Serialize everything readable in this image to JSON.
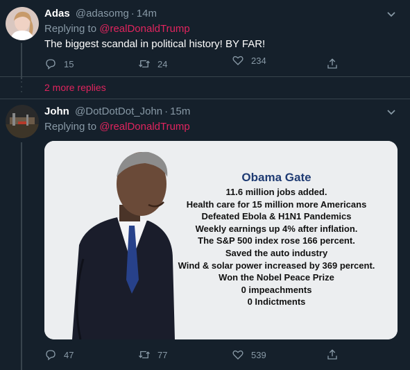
{
  "tweets": [
    {
      "name": "Adas",
      "handle": "@adasomg",
      "time": "14m",
      "replying_label": "Replying to",
      "mention": "@realDonaldTrump",
      "text": "The biggest scandal in political history! BY FAR!",
      "replies": "15",
      "retweets": "24",
      "likes": "234"
    },
    {
      "name": "John",
      "handle": "@DotDotDot_John",
      "time": "15m",
      "replying_label": "Replying to",
      "mention": "@realDonaldTrump",
      "replies": "47",
      "retweets": "77",
      "likes": "539",
      "media": {
        "title": "Obama Gate",
        "lines": [
          "11.6 million jobs added.",
          "Health care for 15 million more Americans",
          "Defeated Ebola & H1N1 Pandemics",
          "Weekly earnings up 4% after inflation.",
          "The S&P 500 index rose 166 percent.",
          "Saved the auto industry",
          "Wind & solar power increased by 369 percent.",
          "Won the Nobel Peace Prize",
          "0 impeachments",
          "0 Indictments"
        ]
      }
    }
  ],
  "more_replies": "2 more replies",
  "colors": {
    "background": "#15202b",
    "muted": "#8899a6",
    "accent": "#e0245e",
    "divider": "#38444d"
  },
  "icons": [
    "reply-icon",
    "retweet-icon",
    "like-icon",
    "share-icon",
    "chevron-down-icon",
    "thread-dots-icon"
  ]
}
